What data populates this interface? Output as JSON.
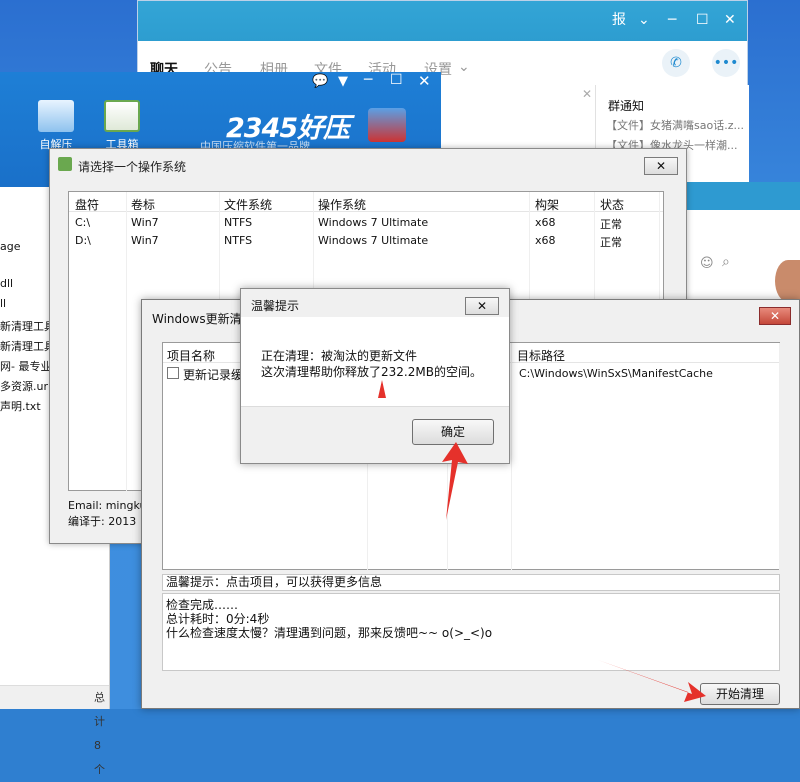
{
  "qq": {
    "title_icon": "报",
    "tabs": [
      "聊天",
      "公告",
      "相册",
      "文件",
      "活动",
      "设置"
    ],
    "notice_title": "群通知",
    "notices": [
      "【文件】女猪满嘴sao话.z...",
      "【文件】像水龙头一样潮..."
    ]
  },
  "haozip": {
    "logo": "2345好压",
    "slogan": "中国压缩软件第一品牌",
    "tools": [
      "自解压",
      "工具箱"
    ]
  },
  "explorer": {
    "items": [
      "age",
      "dll",
      "ll",
      "新清理工具",
      "新清理工具",
      "网- 最专业",
      "多资源.url",
      "声明.txt"
    ],
    "status": "总计 8 个"
  },
  "os_dialog": {
    "title": "请选择一个操作系统",
    "columns": [
      "盘符",
      "卷标",
      "文件系统",
      "操作系统",
      "构架",
      "状态"
    ],
    "rows": [
      [
        "C:\\",
        "Win7",
        "NTFS",
        "Windows 7 Ultimate",
        "x68",
        "正常"
      ],
      [
        "D:\\",
        "Win7",
        "NTFS",
        "Windows 7 Ultimate",
        "x68",
        "正常"
      ]
    ],
    "email": "Email: mingku",
    "compiled": "编译于: 2013"
  },
  "cleanup_dialog": {
    "title": "Windows更新清理",
    "columns": [
      "项目名称",
      "目标路径"
    ],
    "row_name": "更新记录缓存",
    "row_path": "C:\\Windows\\WinSxS\\ManifestCache",
    "tip": "温馨提示：点击项目，可以获得更多信息",
    "log": [
      "检查完成……",
      "总计耗时：0分:4秒",
      "什么检查速度太慢？清理遇到问题，那来反馈吧~~ o(>_<)o"
    ],
    "start_button": "开始清理"
  },
  "popup": {
    "title": "温馨提示",
    "line1": "正在清理：被淘汰的更新文件",
    "line2": "这次清理帮助你释放了232.2MB的空间。",
    "ok": "确定"
  },
  "colors": {
    "qq_blue": "#2d9dd0",
    "haozip_blue": "#1e7fd6",
    "arrow_red": "#e5312b"
  }
}
